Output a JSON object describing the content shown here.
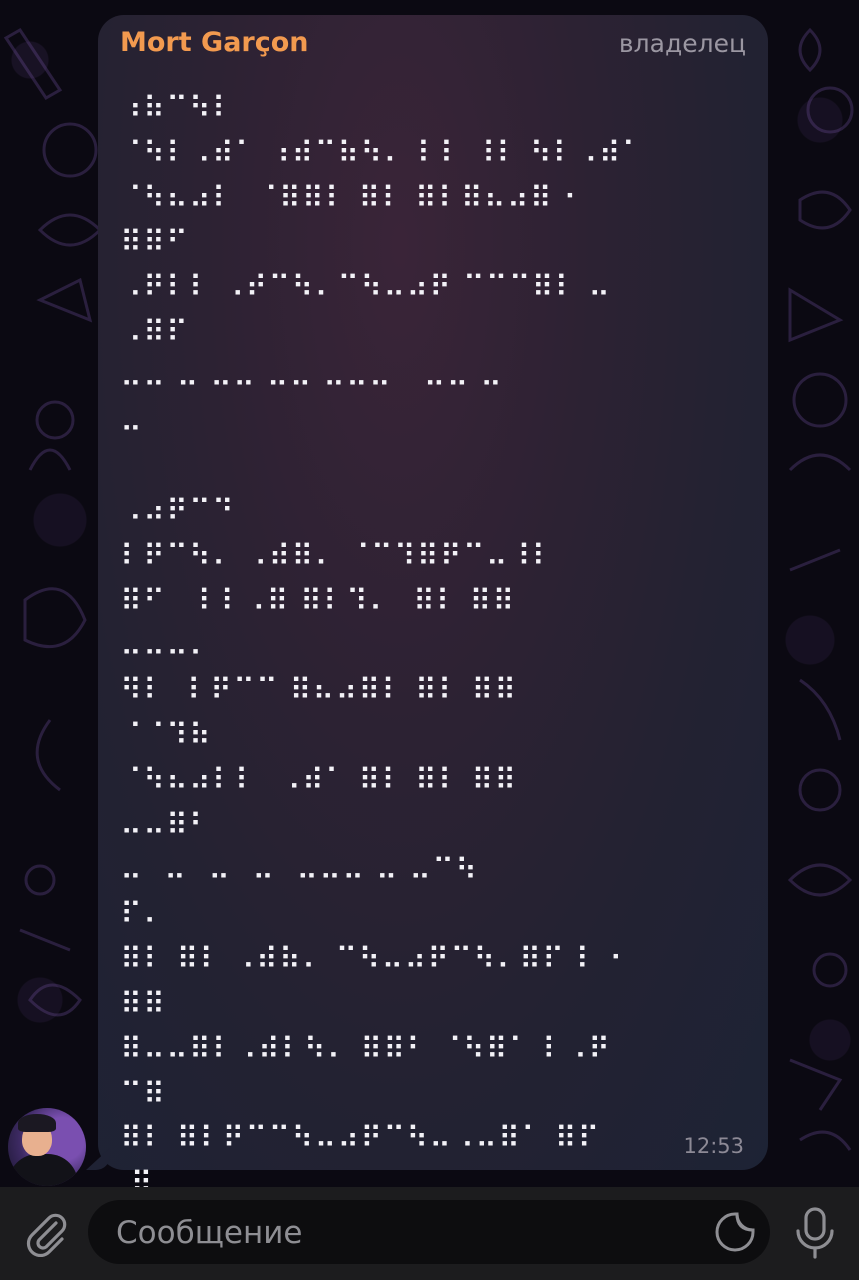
{
  "chat": {
    "sender_name": "Mort Garçon",
    "sender_role": "владелец",
    "message": "⠰⠷⠉⠳⠇\n⠈⠳⠇⠠⠾⠁ ⠰⠾⠉⠷⠳⠄ ⠇⠇ ⠸⠇ ⠳⠇⠠⠾⠁\n⠈⠳⠦⠴⠇  ⠈⠿⠿⠇ ⠿⠇ ⠿⠇⠿⠦⠴⠿ ⠂\n⠿⠿⠋\n⠠⠟⠇⠇ ⠠⠞⠉⠳⠄⠉⠳⠤⠴⠟ ⠉⠉⠉⠿⠇ ⠤\n⠠⠿⠏\n⠤⠤ ⠤ ⠤⠤ ⠤⠤ ⠤⠤⠤   ⠤⠤ ⠤\n⠤\n\n⠠⠴⠟⠉⠙\n⠇⠟⠉⠳⠄ ⠠⠾⠿⠄ ⠈⠉⠹⠿⠟⠉⠤⠸⠇\n⠿⠋   ⠇⠇⠠⠿ ⠿⠇⠹⠄  ⠿⠇ ⠿⠿\n⠤⠤⠤⠄\n⠻⠇  ⠇⠟⠉⠉ ⠿⠦⠴⠿⠇ ⠿⠇ ⠿⠿\n⠈⠈⠹⠷\n⠈⠳⠦⠴⠇⠇  ⠠⠾⠁ ⠿⠇ ⠿⠇ ⠿⠿\n⠤⠤⠿⠃\n⠤  ⠤  ⠤  ⠤  ⠤⠤⠤ ⠤ ⠤⠉⠳\n⠏⠄\n⠿⠇ ⠿⠇ ⠠⠾⠷⠄ ⠉⠳⠤⠴⠟⠉⠳⠄⠿⠏ ⠇ ⠂\n⠿⠿\n⠿⠤⠤⠿⠇⠠⠾⠇⠳⠄ ⠿⠿⠃ ⠈⠳⠿⠁ ⠇⠠⠟\n⠉⠿\n⠿⠇ ⠿⠇⠟⠉⠉⠳⠤⠴⠟⠉⠳⠤⠠⠤⠿⠁ ⠿⠏\n ⠿",
    "time": "12:53"
  },
  "input": {
    "placeholder": "Сообщение",
    "value": ""
  },
  "icons": {
    "attach": "paperclip-icon",
    "sticker": "sticker-icon",
    "mic": "microphone-icon"
  },
  "colors": {
    "sender_name": "#f29a4f",
    "role_label": "#9b97a2",
    "message_text": "#f3f2f7",
    "bubble_top": "#3a2438",
    "bubble_bottom": "#1d2335",
    "input_bar": "#1c1c1e",
    "input_field": "#0d0d0f"
  }
}
